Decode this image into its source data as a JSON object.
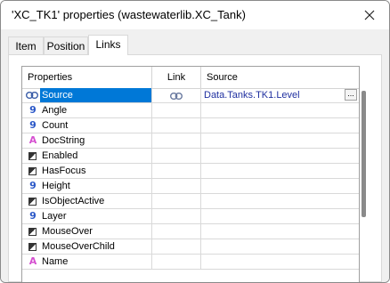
{
  "window": {
    "title": "'XC_TK1' properties (wastewaterlib.XC_Tank)"
  },
  "tabs": [
    {
      "label": "Item"
    },
    {
      "label": "Position"
    },
    {
      "label": "Links"
    }
  ],
  "active_tab": "Links",
  "table": {
    "headers": {
      "properties": "Properties",
      "link": "Link",
      "source": "Source"
    },
    "rows": [
      {
        "icon": "link-icon",
        "name": "Source",
        "linked": true,
        "source": "Data.Tanks.TK1.Level",
        "selected": true
      },
      {
        "icon": "numeric-icon",
        "name": "Angle"
      },
      {
        "icon": "numeric-icon",
        "name": "Count"
      },
      {
        "icon": "string-icon",
        "name": "DocString"
      },
      {
        "icon": "boolean-icon",
        "name": "Enabled"
      },
      {
        "icon": "boolean-icon",
        "name": "HasFocus"
      },
      {
        "icon": "numeric-icon",
        "name": "Height"
      },
      {
        "icon": "boolean-icon",
        "name": "IsObjectActive"
      },
      {
        "icon": "numeric-icon",
        "name": "Layer"
      },
      {
        "icon": "boolean-icon",
        "name": "MouseOver"
      },
      {
        "icon": "boolean-icon",
        "name": "MouseOverChild"
      },
      {
        "icon": "string-icon",
        "name": "Name"
      }
    ]
  },
  "browse_button": "...",
  "colors": {
    "selection": "#0078d7",
    "numeric_icon": "#2a57c7",
    "string_icon": "#d54fd0",
    "source_text": "#2030a0"
  }
}
